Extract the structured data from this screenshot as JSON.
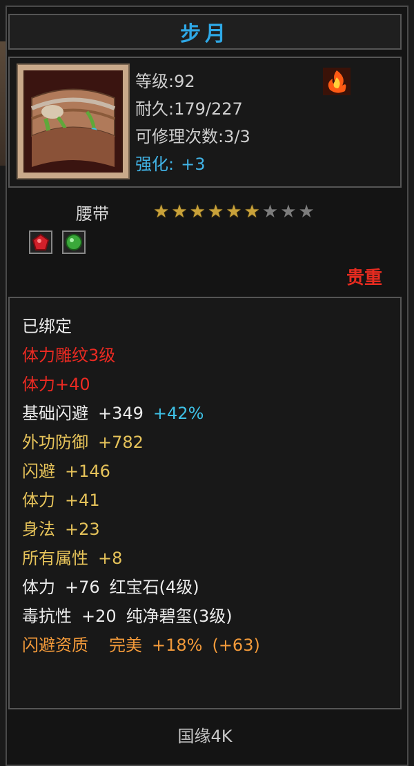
{
  "item": {
    "name": "步月",
    "level_label": "等级:",
    "level": "92",
    "durability_label": "耐久:",
    "durability": "179/227",
    "repair_label": "可修理次数:",
    "repair": "3/3",
    "enhance_label": "强化:",
    "enhance": "+3",
    "type": "腰带",
    "stars_total": 9,
    "stars_filled": 6,
    "grade": "贵重",
    "gems": [
      "ruby-gem-icon",
      "jade-gem-icon"
    ]
  },
  "attributes": {
    "bound": "已绑定",
    "engraving": "体力雕纹3级",
    "engraving_bonus": "体力+40",
    "base_dodge_label": "基础闪避",
    "base_dodge_value": "+349",
    "base_dodge_pct": "+42%",
    "outer_def_label": "外功防御",
    "outer_def_value": "+782",
    "dodge_label": "闪避",
    "dodge_value": "+146",
    "vit_label": "体力",
    "vit_value": "+41",
    "agi_label": "身法",
    "agi_value": "+23",
    "all_label": "所有属性",
    "all_value": "+8",
    "gem1_label": "体力",
    "gem1_value": "+76",
    "gem1_name": "红宝石(4级)",
    "gem2_label": "毒抗性",
    "gem2_value": "+20",
    "gem2_name": "纯净碧玺(3级)",
    "quality_label": "闪避资质",
    "quality_grade": "完美",
    "quality_value": "+18%",
    "quality_bonus": "(+63)"
  },
  "footer": {
    "server": "国缘4K"
  },
  "colors": {
    "title": "#2ea8e6",
    "grade": "#e62b20",
    "star_on": "#c9a23a",
    "star_off": "#7c7c7c"
  }
}
